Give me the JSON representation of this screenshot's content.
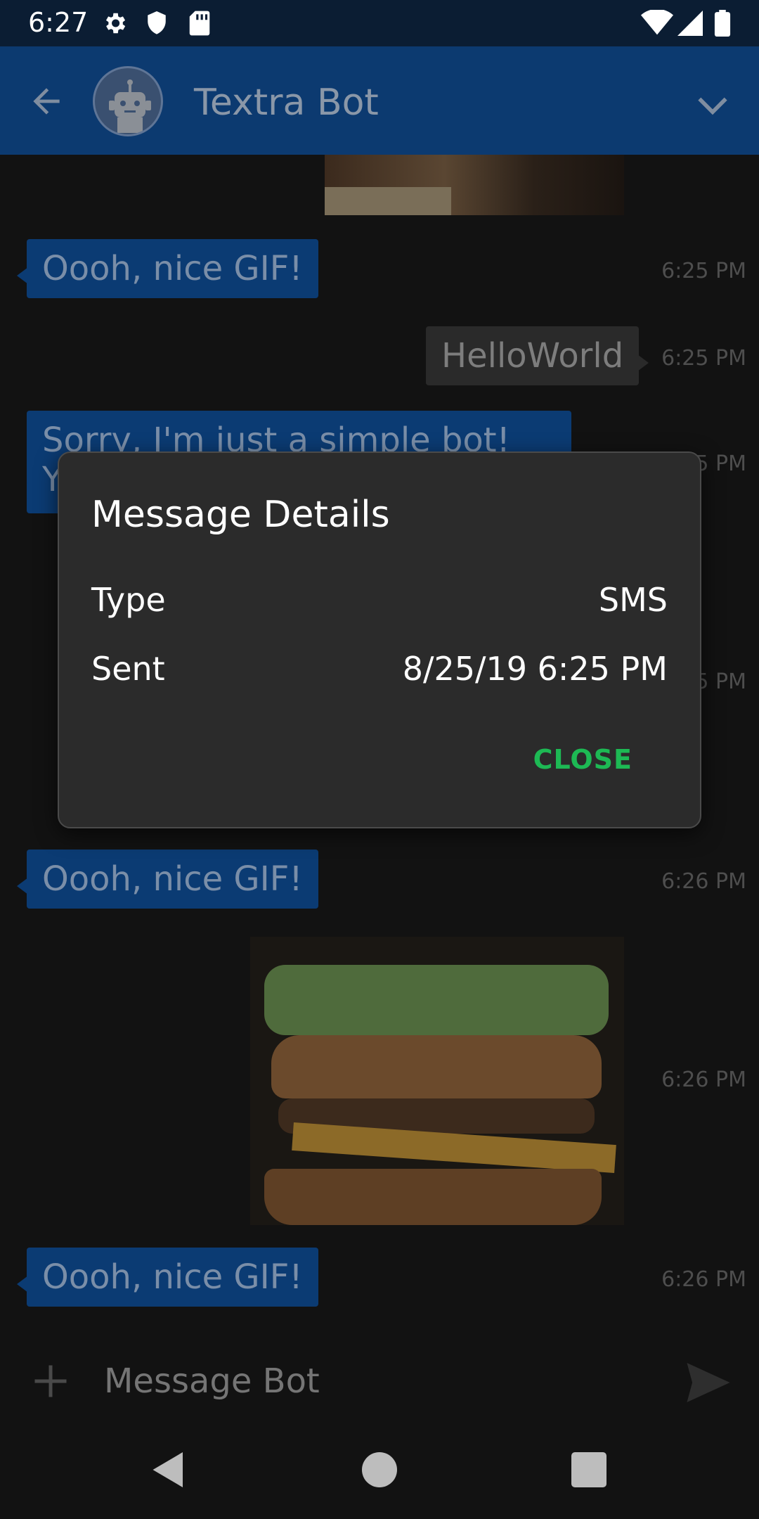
{
  "status_bar": {
    "time": "6:27",
    "icons": [
      "settings-icon",
      "shield-icon",
      "sd-card-icon",
      "wifi-icon",
      "signal-icon",
      "battery-icon"
    ]
  },
  "app_bar": {
    "title": "Textra Bot",
    "back_icon": "arrow-back-icon",
    "expand_icon": "chevron-down-icon",
    "avatar_icon": "robot-avatar-icon"
  },
  "messages": [
    {
      "direction": "in",
      "text": "Oooh, nice GIF!",
      "time": "6:25 PM"
    },
    {
      "direction": "out",
      "text": "HelloWorld",
      "time": "6:25 PM"
    },
    {
      "direction": "in",
      "text": "Sorry, I'm just a simple bot! You c",
      "time": "6:25 PM"
    },
    {
      "direction": "in",
      "text": "",
      "time": "6:25 PM"
    },
    {
      "direction": "in",
      "text": "Oooh, nice GIF!",
      "time": "6:26 PM"
    },
    {
      "direction": "out",
      "text": "",
      "time": "6:26 PM",
      "media": "burger-gif"
    },
    {
      "direction": "in",
      "text": "Oooh, nice GIF!",
      "time": "6:26 PM"
    }
  ],
  "compose": {
    "placeholder": "Message Bot",
    "attach_icon": "plus-icon",
    "send_icon": "send-icon"
  },
  "dialog": {
    "title": "Message Details",
    "rows": [
      {
        "label": "Type",
        "value": "SMS"
      },
      {
        "label": "Sent",
        "value": "8/25/19 6:25 PM"
      }
    ],
    "close_label": "CLOSE",
    "accent_color": "#1db954"
  },
  "nav_bar": {
    "buttons": [
      "back-triangle-icon",
      "home-circle-icon",
      "recents-square-icon"
    ]
  },
  "colors": {
    "app_bar": "#0c3a70",
    "status_bar": "#0b1d33",
    "incoming_bubble": "#0b3b73",
    "background": "#121212",
    "dialog_bg": "#2b2b2b"
  }
}
